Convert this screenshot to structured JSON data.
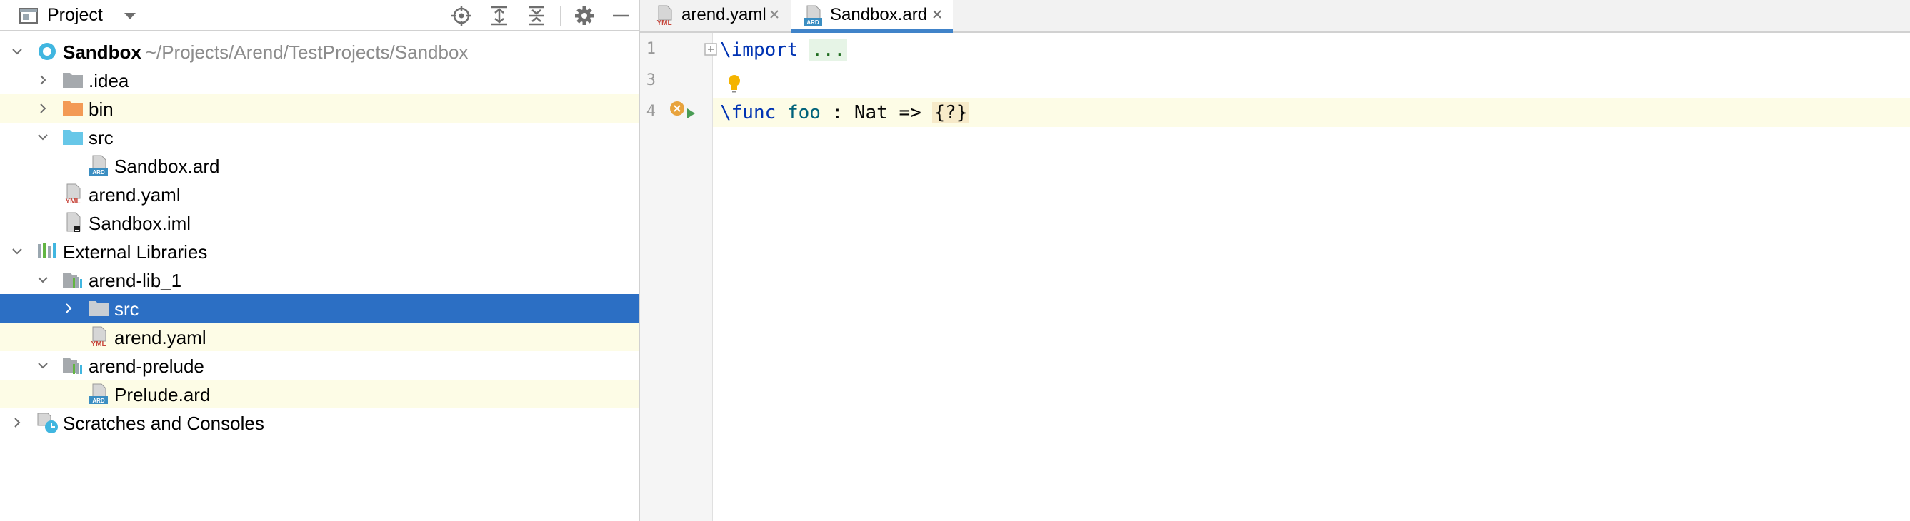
{
  "project_pane": {
    "title": "Project",
    "header_icons": [
      "project-view-icon",
      "dropdown-arrow-icon",
      "locate-icon",
      "expand-all-icon",
      "collapse-all-icon",
      "gear-icon",
      "minimize-icon"
    ],
    "tree": [
      {
        "label": "Sandbox",
        "path": "~/Projects/Arend/TestProjects/Sandbox",
        "icon": "module-icon",
        "expanded": true
      },
      {
        "label": ".idea",
        "icon": "folder-icon"
      },
      {
        "label": "bin",
        "icon": "excluded-folder-icon"
      },
      {
        "label": "src",
        "icon": "source-folder-icon",
        "expanded": true
      },
      {
        "label": "Sandbox.ard",
        "icon": "ard-file-icon"
      },
      {
        "label": "arend.yaml",
        "icon": "yaml-file-icon"
      },
      {
        "label": "Sandbox.iml",
        "icon": "iml-file-icon"
      },
      {
        "label": "External Libraries",
        "icon": "libraries-icon",
        "expanded": true
      },
      {
        "label": "arend-lib_1",
        "icon": "library-icon",
        "expanded": true
      },
      {
        "label": "src",
        "icon": "folder-icon",
        "selected": true
      },
      {
        "label": "arend.yaml",
        "icon": "yaml-file-icon"
      },
      {
        "label": "arend-prelude",
        "icon": "library-icon",
        "expanded": true
      },
      {
        "label": "Prelude.ard",
        "icon": "ard-file-icon"
      },
      {
        "label": "Scratches and Consoles",
        "icon": "scratches-icon"
      }
    ]
  },
  "editor": {
    "tabs": [
      {
        "label": "arend.yaml",
        "icon": "yaml-file-icon",
        "active": false
      },
      {
        "label": "Sandbox.ard",
        "icon": "ard-file-icon",
        "active": true
      }
    ],
    "line_numbers": [
      "1",
      "3",
      "4"
    ],
    "code": {
      "line1_kw": "\\import",
      "line1_fold": "...",
      "line4_kw": "\\func",
      "line4_name": "foo",
      "line4_rest": " : Nat => ",
      "line4_goal": "{?}"
    }
  },
  "colors": {
    "selection": "#2c6fc4",
    "modified_row": "#fdfce6",
    "keyword": "#0033b3",
    "function_name": "#00627a",
    "active_tab_underline": "#4083c9"
  }
}
